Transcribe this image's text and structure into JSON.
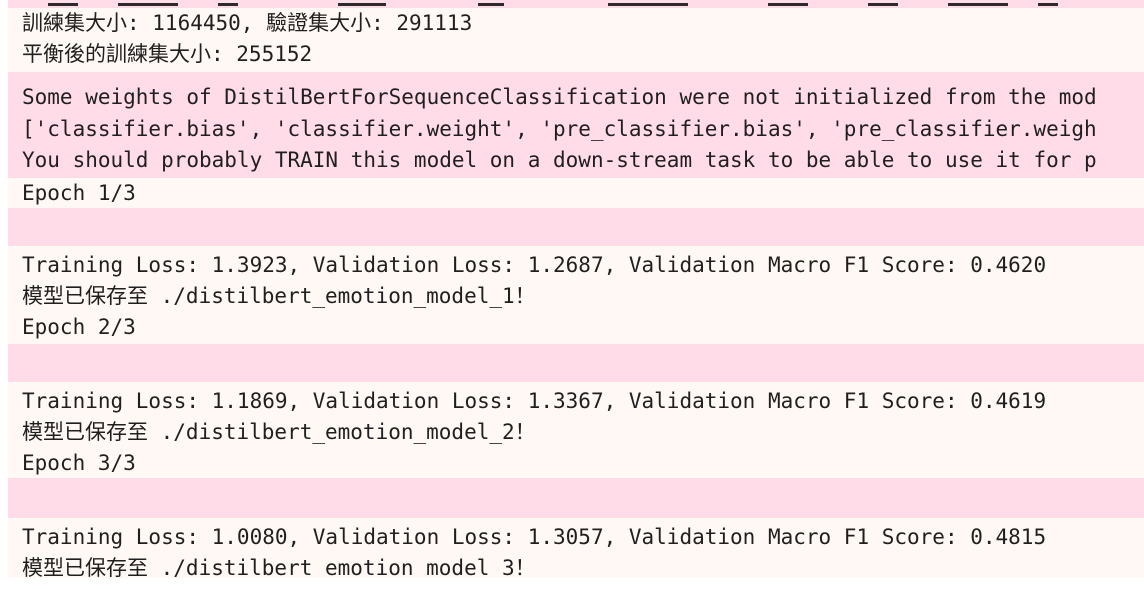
{
  "data_info": {
    "train_size_line": "訓練集大小: 1164450, 驗證集大小: 291113",
    "balanced_line": "平衡後的訓練集大小: 255152"
  },
  "warning": {
    "line1": "Some weights of DistilBertForSequenceClassification were not initialized from the mod",
    "line2": "['classifier.bias', 'classifier.weight', 'pre_classifier.bias', 'pre_classifier.weigh",
    "line3": "You should probably TRAIN this model on a down-stream task to be able to use it for p"
  },
  "epochs": [
    {
      "header": "Epoch 1/3",
      "metrics": "Training Loss: 1.3923, Validation Loss: 1.2687, Validation Macro F1 Score: 0.4620",
      "saved": "模型已保存至 ./distilbert_emotion_model_1！"
    },
    {
      "header": "Epoch 2/3",
      "metrics": "Training Loss: 1.1869, Validation Loss: 1.3367, Validation Macro F1 Score: 0.4619",
      "saved": "模型已保存至 ./distilbert_emotion_model_2！"
    },
    {
      "header": "Epoch 3/3",
      "metrics": "Training Loss: 1.0080, Validation Loss: 1.3057, Validation Macro F1 Score: 0.4815",
      "saved": "模型已保存至 ./distilbert_emotion_model_3！"
    }
  ],
  "colors": {
    "stdout_bg": "#fff8f4",
    "stderr_bg": "#ffdce8",
    "text": "#1f1f1f"
  }
}
